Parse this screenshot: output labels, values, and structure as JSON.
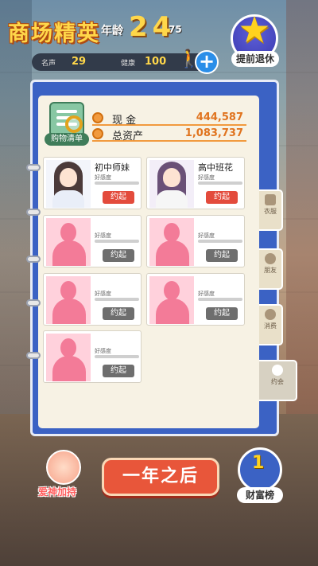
{
  "header": {
    "title": "商场精英",
    "age_label": "年龄",
    "age_value": "24",
    "age_max": "75",
    "fame_label": "名声",
    "fame_value": "29",
    "health_label": "健康",
    "health_value": "100",
    "retire_label": "提前退休"
  },
  "finance": {
    "shopping_list_label": "购物清单",
    "cash_label": "现 金",
    "cash_value": "444,587",
    "assets_label": "总资产",
    "assets_value": "1,083,737"
  },
  "cards": [
    {
      "name": "初中师妹",
      "fav_label": "好感度",
      "button": "约起",
      "unlocked": true
    },
    {
      "name": "高中班花",
      "fav_label": "好感度",
      "button": "约起",
      "unlocked": true
    },
    {
      "name": "",
      "fav_label": "好感度",
      "button": "约起",
      "unlocked": false
    },
    {
      "name": "",
      "fav_label": "好感度",
      "button": "约起",
      "unlocked": false
    },
    {
      "name": "",
      "fav_label": "好感度",
      "button": "约起",
      "unlocked": false
    },
    {
      "name": "",
      "fav_label": "好感度",
      "button": "约起",
      "unlocked": false
    },
    {
      "name": "",
      "fav_label": "好感度",
      "button": "约起",
      "unlocked": false
    }
  ],
  "tabs": [
    {
      "label": "衣服"
    },
    {
      "label": "朋友"
    },
    {
      "label": "消费"
    },
    {
      "label": "约会"
    }
  ],
  "bottom": {
    "cupid_label": "爱神加持",
    "next_year_label": "一年之后",
    "rank_number": "1",
    "rank_label": "财富榜"
  },
  "colors": {
    "book_blue": "#3b62c4",
    "accent_orange": "#f19a3e",
    "date_red": "#e34b3c",
    "title_yellow": "#ffd74a"
  }
}
